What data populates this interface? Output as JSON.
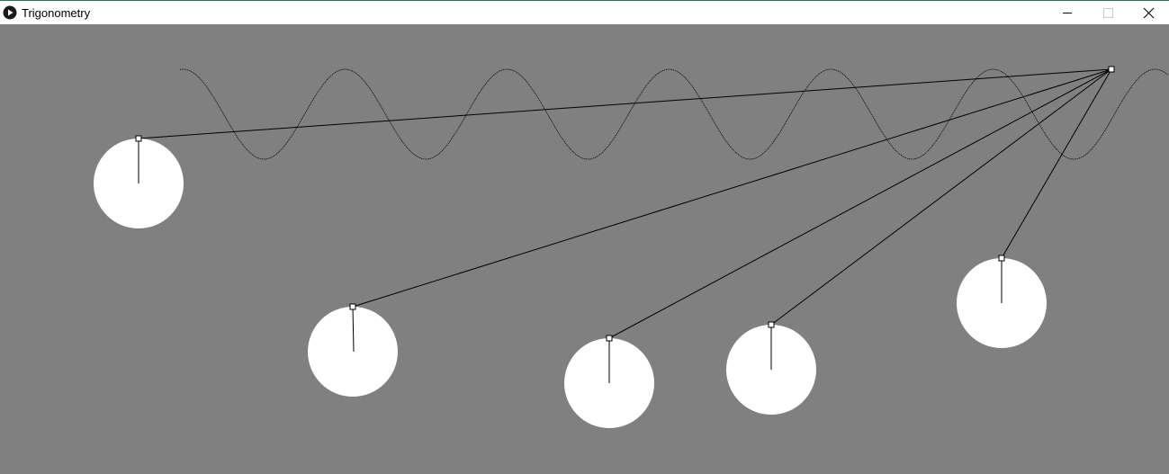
{
  "window": {
    "title": "Trigonometry",
    "app_icon": "play-circle-icon",
    "controls": {
      "minimize_icon": "minimize-icon",
      "maximize_icon": "maximize-icon",
      "close_icon": "close-icon"
    }
  },
  "canvas": {
    "background_color": "#808080",
    "line_color": "#000000",
    "ball_color": "#ffffff"
  }
}
